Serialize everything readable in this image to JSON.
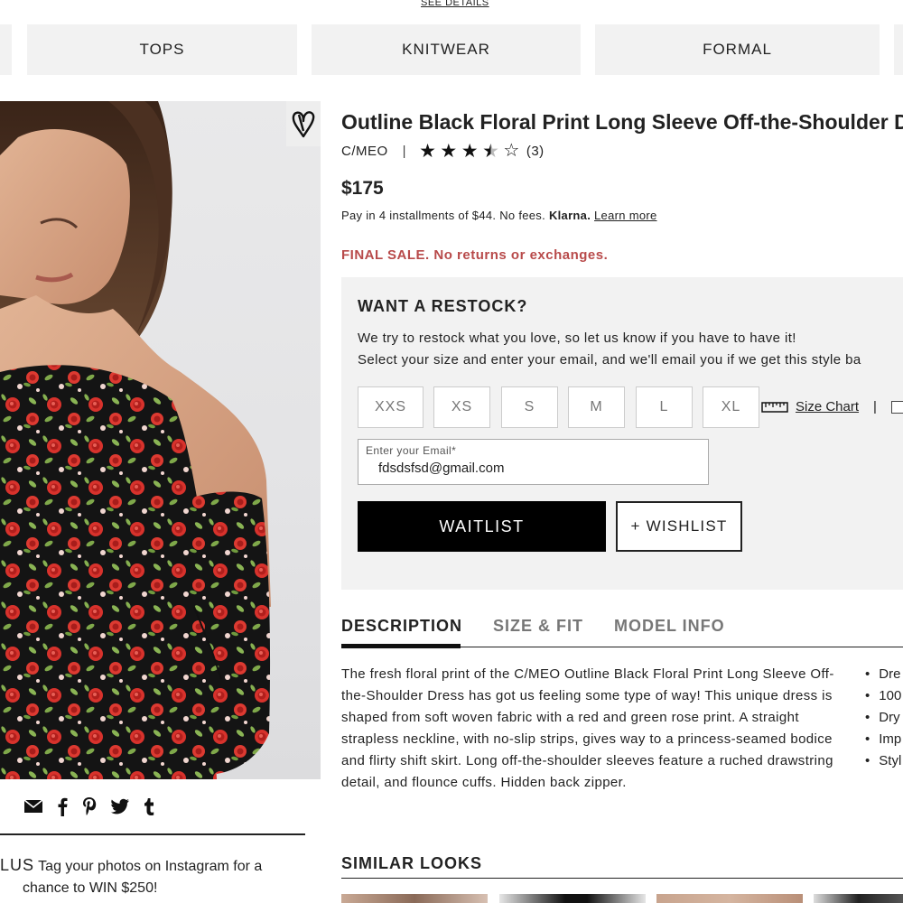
{
  "promo": {
    "see_details": "SEE DETAILS"
  },
  "categories": [
    "TOPS",
    "KNITWEAR",
    "FORMAL"
  ],
  "product": {
    "title": "Outline Black Floral Print Long Sleeve Off-the-Shoulder D",
    "brand": "C/MEO",
    "separator": "|",
    "rating": 3.5,
    "rating_max": 5,
    "rating_count": "(3)",
    "price": "$175",
    "installments_text": "Pay in 4 installments of $44. No fees.",
    "klarna": "Klarna.",
    "learn_more": "Learn more",
    "final_sale": "FINAL SALE. No returns or exchanges."
  },
  "restock": {
    "title": "WANT A RESTOCK?",
    "line1": "We try to restock what you love, so let us know if you have to have it!",
    "line2": "Select your size and enter your email, and we'll email you if we get this style ba",
    "sizes": [
      "XXS",
      "XS",
      "S",
      "M",
      "L",
      "XL"
    ],
    "size_chart": "Size Chart",
    "separator": "|",
    "email_label": "Enter your Email*",
    "email_value": "fdsdsfsd@gmail.com",
    "waitlist_label": "WAITLIST",
    "wishlist_label": "+ WISHLIST"
  },
  "tabs": [
    "DESCRIPTION",
    "SIZE & FIT",
    "MODEL INFO"
  ],
  "description": "The fresh floral print of the C/MEO Outline Black Floral Print Long Sleeve Off-the-Shoulder Dress has got us feeling some type of way! This unique dress is shaped from soft woven fabric with a red and green rose print. A straight strapless neckline, with no-slip strips, gives way to a princess-seamed bodice and flirty shift skirt. Long off-the-shoulder sleeves feature a ruched drawstring detail, and flounce cuffs. Hidden back zipper.",
  "bullets": [
    "Dre",
    "100",
    "Dry",
    "Imp",
    "Styl"
  ],
  "share_icons": [
    "email-icon",
    "facebook-icon",
    "pinterest-icon",
    "twitter-icon",
    "tumblr-icon"
  ],
  "instagram": {
    "prefix": "LUS",
    "text": "Tag your photos on Instagram for a",
    "text2": "chance to WIN $250!"
  },
  "similar_title": "SIMILAR LOOKS",
  "colors": {
    "accent_red": "#b84a4a",
    "panel_bg": "#f2f2f2",
    "button_black": "#000000"
  }
}
